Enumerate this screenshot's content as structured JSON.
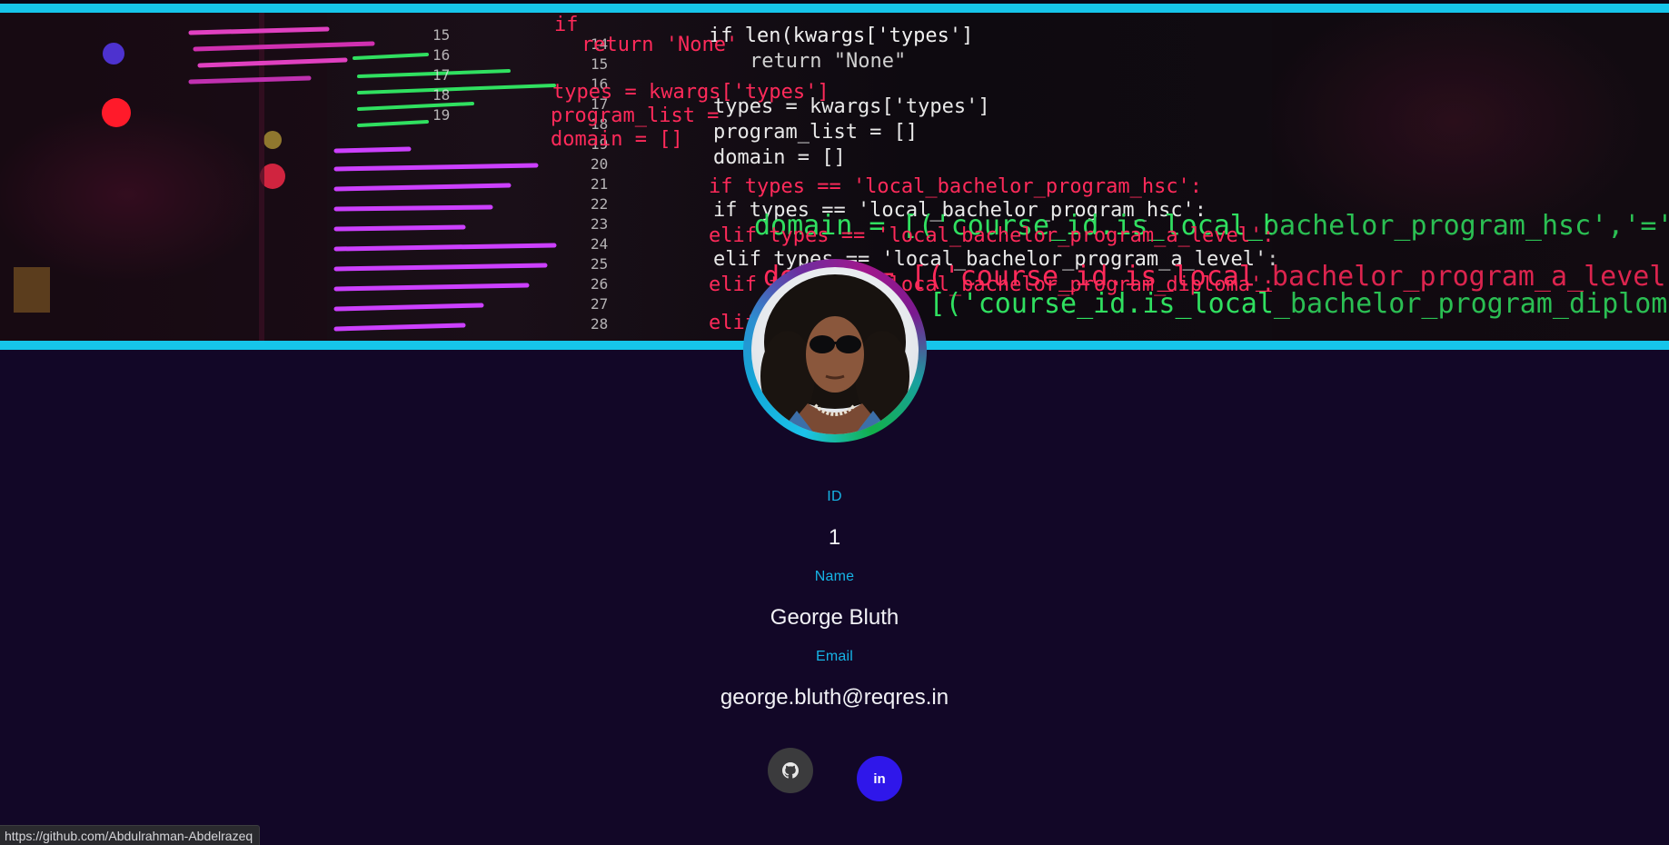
{
  "banner": {
    "image": "code-background"
  },
  "profile": {
    "avatar": "user-avatar-photo",
    "id_label": "ID",
    "id_value": "1",
    "name_label": "Name",
    "name_value": "George Bluth",
    "email_label": "Email",
    "email_value": "george.bluth@reqres.in"
  },
  "social": {
    "github_icon": "github-icon",
    "linkedin_label": "in"
  },
  "status_bar": {
    "url": "https://github.com/Abdulrahman-Abdelrazeq"
  },
  "colors": {
    "background": "#120727",
    "accent": "#16c5ea",
    "label": "#16b4e6",
    "github_button": "#3b3b3d",
    "linkedin_button": "#2f17ea"
  }
}
